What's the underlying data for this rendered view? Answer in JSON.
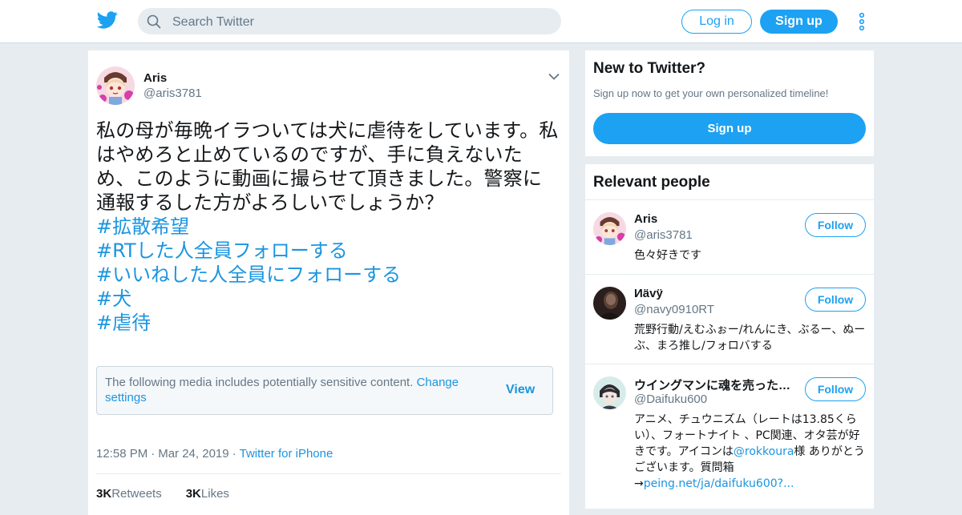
{
  "header": {
    "search_placeholder": "Search Twitter",
    "login_label": "Log in",
    "signup_label": "Sign up",
    "brand_color": "#1da1f2"
  },
  "tweet": {
    "author_name": "Aris",
    "author_handle": "@aris3781",
    "body": "私の母が毎晩イラついては犬に虐待をしています。私はやめろと止めているのですが、手に負えないため、このように動画に撮らせて頂きました。警察に通報するした方がよろしいでしょうか？",
    "hashtags": [
      "#拡散希望",
      "#RTした人全員フォローする",
      "#いいねした人全員にフォローする",
      "#犬",
      "#虐待"
    ],
    "sensitive_notice": "The following media includes potentially sensitive content.",
    "sensitive_link": "Change settings",
    "view_label": "View",
    "time": "12:58 PM",
    "date": "Mar 24, 2019",
    "source": "Twitter for iPhone",
    "retweets_count": "3K",
    "retweets_label": "Retweets",
    "likes_count": "3K",
    "likes_label": "Likes"
  },
  "signup_card": {
    "title": "New to Twitter?",
    "subtitle": "Sign up now to get your own personalized timeline!",
    "button_label": "Sign up"
  },
  "relevant_people": {
    "title": "Relevant people",
    "follow_label": "Follow",
    "people": [
      {
        "name": "Aris",
        "handle": "@aris3781",
        "bio": "色々好きです"
      },
      {
        "name": "Иävÿ",
        "handle": "@navy0910RT",
        "bio": "荒野行動/えむふぉー/れんにき、ぶるー、ぬーぶ、まろ推し/フォロバする"
      },
      {
        "name": "ウイングマンに魂を売った…",
        "handle": "@Daifuku600",
        "bio_prefix": "アニメ、チュウニズム（レートは13.85くらい）、フォートナイト 、PC関連、オタ芸が好きです。アイコンは",
        "bio_mention": "@rokkoura",
        "bio_suffix": "様 ありがとうございます。質問箱→",
        "bio_link": "peing.net/ja/daifuku600?..."
      }
    ]
  }
}
